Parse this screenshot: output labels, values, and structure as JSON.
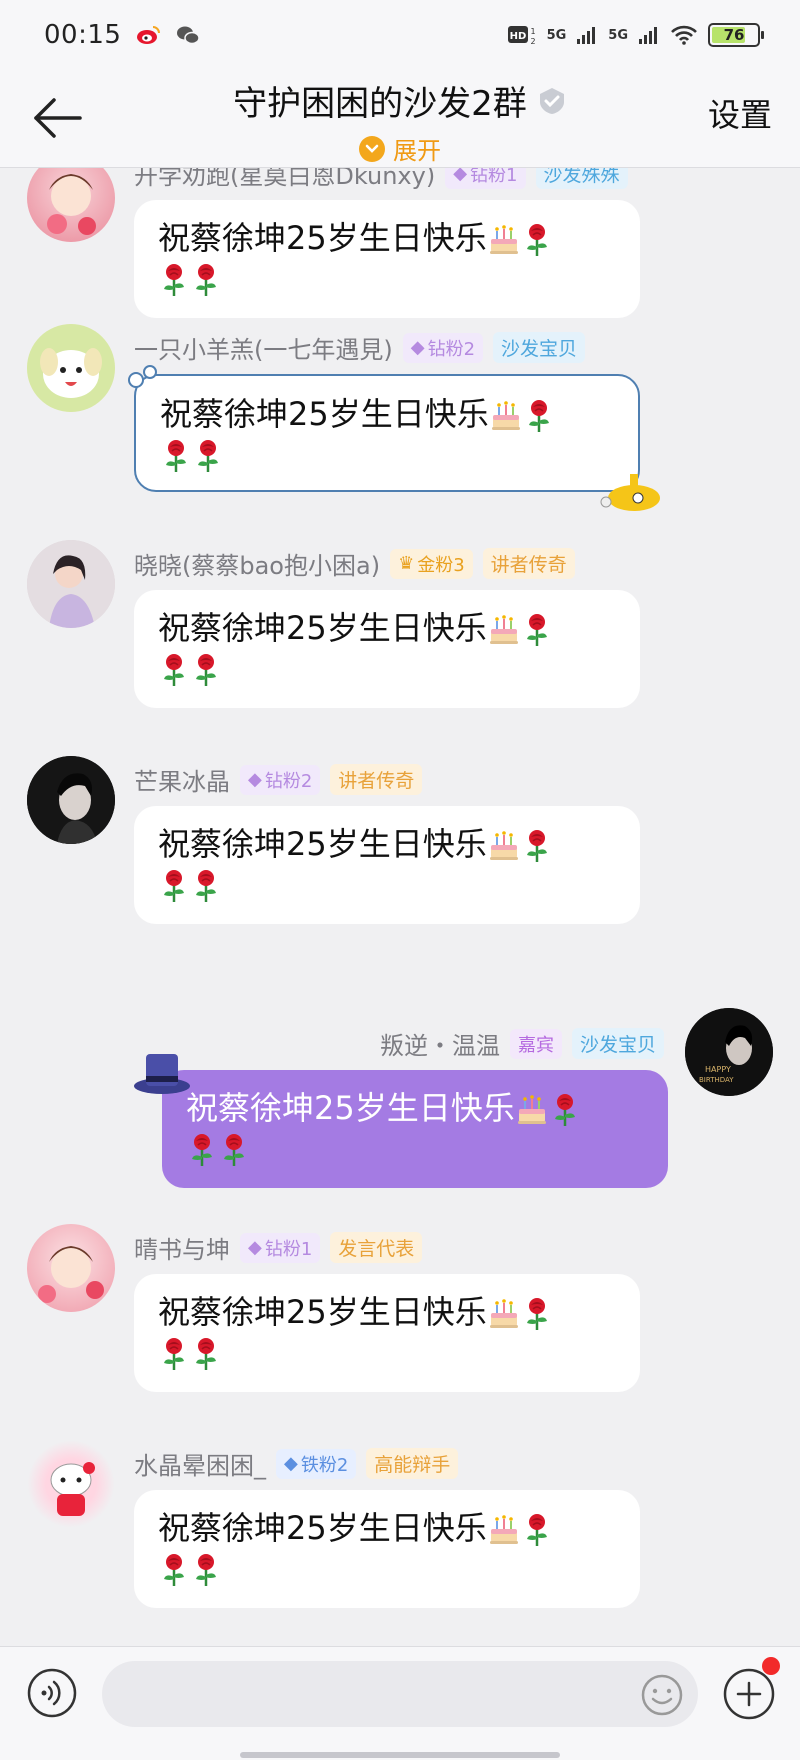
{
  "status": {
    "time": "00:15",
    "net1": "5G",
    "net2": "5G",
    "battery": "76",
    "battery_level": 0.76
  },
  "header": {
    "title": "守护困困的沙发2群",
    "expand_label": "展开",
    "settings_label": "设置"
  },
  "messages": [
    {
      "name": "开学劝跑(星莫白恩Dkunxy)",
      "badge": "钻粉1",
      "tag": "沙发殊殊",
      "text": "祝蔡徐坤25岁生日快乐"
    },
    {
      "name": "一只小羊羔(一七年遇見)",
      "badge": "钻粉2",
      "tag": "沙发宝贝",
      "text": "祝蔡徐坤25岁生日快乐"
    },
    {
      "name": "晓晓(蔡蔡bao抱小困a)",
      "badge": "金粉3",
      "tag": "讲者传奇",
      "text": "祝蔡徐坤25岁生日快乐"
    },
    {
      "name": "芒果冰晶",
      "badge": "钻粉2",
      "tag": "讲者传奇",
      "text": "祝蔡徐坤25岁生日快乐"
    },
    {
      "name": "叛逆・温温",
      "badge": "嘉宾",
      "tag": "沙发宝贝",
      "text": "祝蔡徐坤25岁生日快乐"
    },
    {
      "name": "晴书与坤",
      "badge": "钻粉1",
      "tag": "发言代表",
      "text": "祝蔡徐坤25岁生日快乐"
    },
    {
      "name": "水晶晕困困_",
      "badge": "铁粉2",
      "tag": "高能辩手",
      "text": "祝蔡徐坤25岁生日快乐"
    }
  ],
  "colors": {
    "accent_orange": "#f09a14",
    "self_bubble": "#a47be3",
    "badge_diamond": "#b58ae0",
    "tag_blue": "#4ea7dd"
  }
}
